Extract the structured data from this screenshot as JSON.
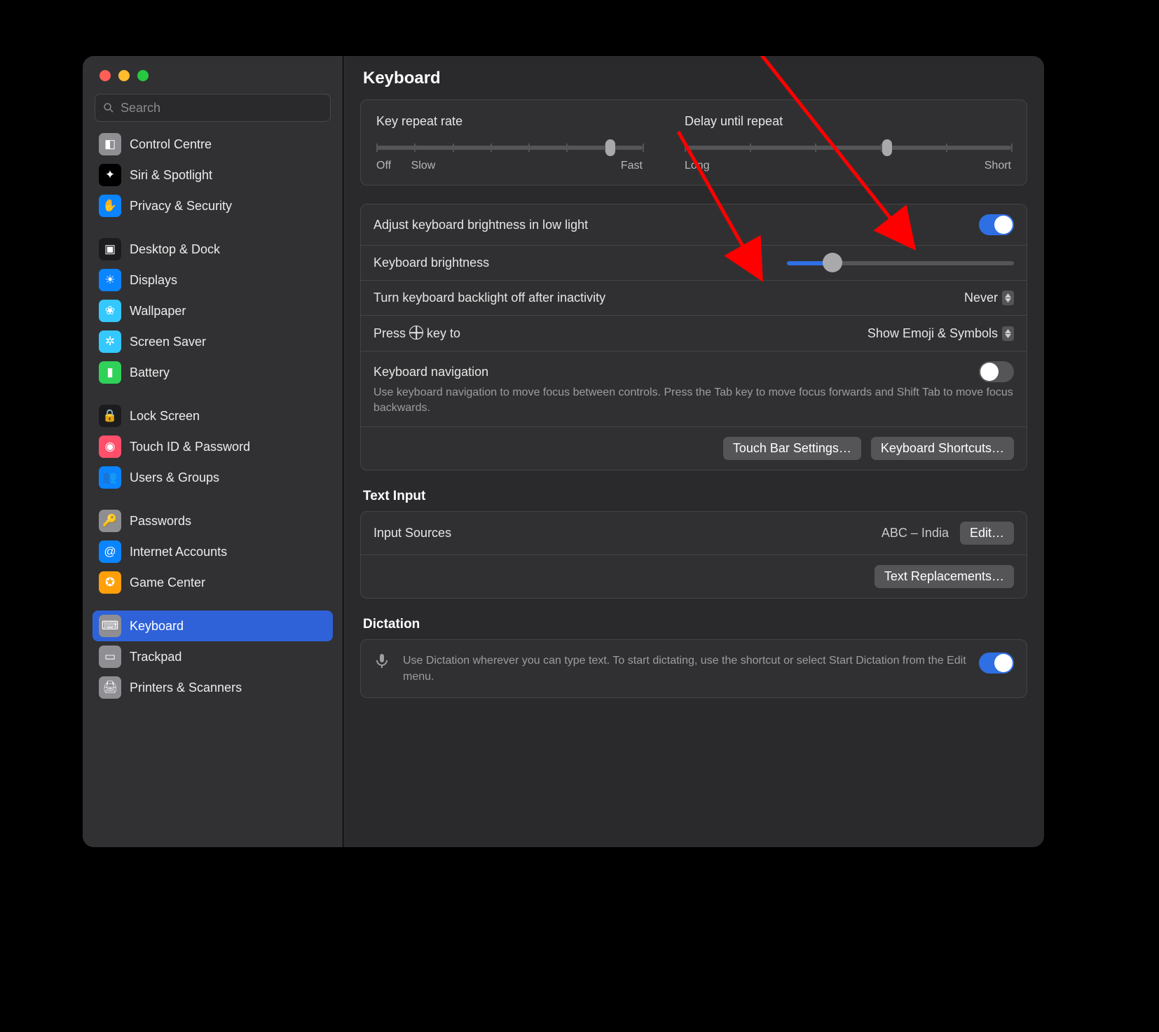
{
  "search": {
    "placeholder": "Search"
  },
  "pageTitle": "Keyboard",
  "sidebar": {
    "groups": [
      [
        {
          "label": "Control Centre",
          "color": "#8e8e93",
          "glyph": "◧"
        },
        {
          "label": "Siri & Spotlight",
          "color": "#000",
          "glyph": "✦"
        },
        {
          "label": "Privacy & Security",
          "color": "#0a84ff",
          "glyph": "✋"
        }
      ],
      [
        {
          "label": "Desktop & Dock",
          "color": "#1c1c1e",
          "glyph": "▣"
        },
        {
          "label": "Displays",
          "color": "#0a84ff",
          "glyph": "☀"
        },
        {
          "label": "Wallpaper",
          "color": "#34c8ff",
          "glyph": "❀"
        },
        {
          "label": "Screen Saver",
          "color": "#34c8ff",
          "glyph": "✲"
        },
        {
          "label": "Battery",
          "color": "#30d158",
          "glyph": "▮"
        }
      ],
      [
        {
          "label": "Lock Screen",
          "color": "#1c1c1e",
          "glyph": "🔒"
        },
        {
          "label": "Touch ID & Password",
          "color": "#ff4f6b",
          "glyph": "◉"
        },
        {
          "label": "Users & Groups",
          "color": "#0a84ff",
          "glyph": "👥"
        }
      ],
      [
        {
          "label": "Passwords",
          "color": "#8e8e93",
          "glyph": "🔑"
        },
        {
          "label": "Internet Accounts",
          "color": "#0a84ff",
          "glyph": "@"
        },
        {
          "label": "Game Center",
          "color": "#ff9f0a",
          "glyph": "✪"
        }
      ],
      [
        {
          "label": "Keyboard",
          "color": "#8e8e93",
          "glyph": "⌨",
          "selected": true
        },
        {
          "label": "Trackpad",
          "color": "#8e8e93",
          "glyph": "▭"
        },
        {
          "label": "Printers & Scanners",
          "color": "#8e8e93",
          "glyph": "🖨"
        }
      ]
    ]
  },
  "keyRepeat": {
    "title": "Key repeat rate",
    "labels": {
      "left": "Off",
      "mid": "Slow",
      "right": "Fast"
    },
    "position": 0.88
  },
  "delayRepeat": {
    "title": "Delay until repeat",
    "labels": {
      "left": "Long",
      "right": "Short"
    },
    "position": 0.62
  },
  "rows": {
    "adjustLowLight": {
      "label": "Adjust keyboard brightness in low light",
      "on": true
    },
    "brightness": {
      "label": "Keyboard brightness",
      "value": 0.2
    },
    "backlightOff": {
      "label": "Turn keyboard backlight off after inactivity",
      "value": "Never"
    },
    "globeKey": {
      "prefix": "Press ",
      "suffix": " key to",
      "value": "Show Emoji & Symbols"
    },
    "keyboardNav": {
      "label": "Keyboard navigation",
      "desc": "Use keyboard navigation to move focus between controls. Press the Tab key to move focus forwards and Shift Tab to move focus backwards.",
      "on": false
    },
    "buttons": {
      "touchbar": "Touch Bar Settings…",
      "shortcuts": "Keyboard Shortcuts…"
    }
  },
  "textInput": {
    "heading": "Text Input",
    "inputSourcesLabel": "Input Sources",
    "inputSourcesValue": "ABC – India",
    "edit": "Edit…",
    "textRepl": "Text Replacements…"
  },
  "dictation": {
    "heading": "Dictation",
    "desc": "Use Dictation wherever you can type text. To start dictating, use the shortcut or select Start Dictation from the Edit menu.",
    "on": true
  }
}
